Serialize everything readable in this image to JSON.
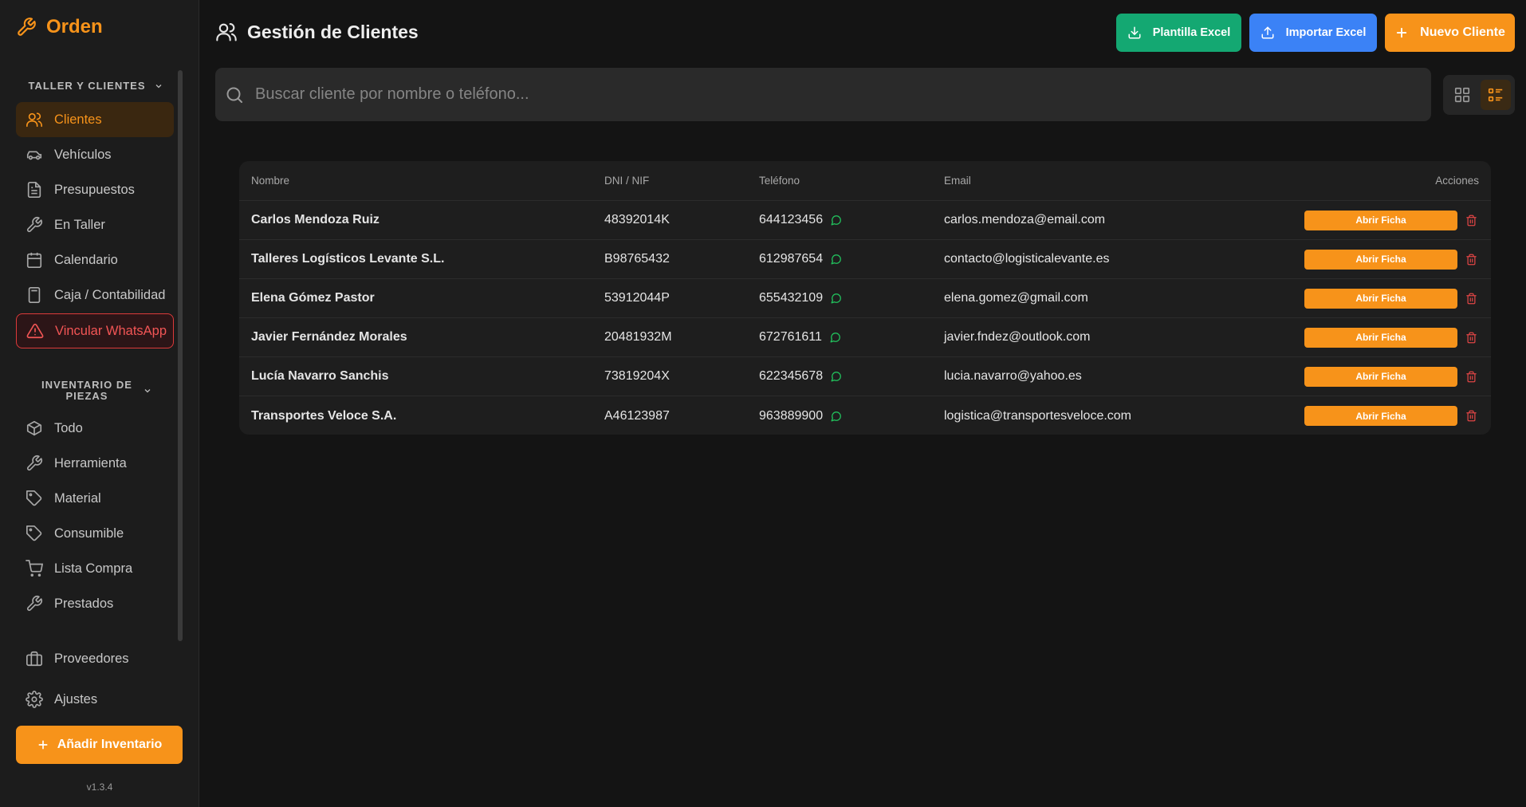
{
  "app": {
    "name": "Orden"
  },
  "sidebar": {
    "section1": "TALLER Y CLIENTES",
    "items1": [
      {
        "label": "Clientes",
        "icon": "users-icon",
        "active": true
      },
      {
        "label": "Vehículos",
        "icon": "car-icon"
      },
      {
        "label": "Presupuestos",
        "icon": "document-icon"
      },
      {
        "label": "En Taller",
        "icon": "wrench-icon"
      },
      {
        "label": "Calendario",
        "icon": "calendar-icon"
      },
      {
        "label": "Caja / Contabilidad",
        "icon": "calculator-icon"
      },
      {
        "label": "Vincular WhatsApp",
        "icon": "warning-icon",
        "alert": true
      }
    ],
    "section2": "INVENTARIO DE PIEZAS",
    "items2": [
      {
        "label": "Todo",
        "icon": "box-icon"
      },
      {
        "label": "Herramienta",
        "icon": "wrench-icon"
      },
      {
        "label": "Material",
        "icon": "tag-icon"
      },
      {
        "label": "Consumible",
        "icon": "tag-icon"
      },
      {
        "label": "Lista Compra",
        "icon": "cart-icon"
      },
      {
        "label": "Prestados",
        "icon": "wrench-icon"
      }
    ],
    "bottom": [
      {
        "label": "Proveedores",
        "icon": "briefcase-icon"
      },
      {
        "label": "Ajustes",
        "icon": "gear-icon"
      }
    ],
    "add_button": "Añadir Inventario",
    "version": "v1.3.4"
  },
  "header": {
    "title": "Gestión de Clientes",
    "btn_template": "Plantilla Excel",
    "btn_import": "Importar Excel",
    "btn_new": "Nuevo Cliente"
  },
  "search": {
    "placeholder": "Buscar cliente por nombre o teléfono..."
  },
  "table": {
    "columns": [
      "Nombre",
      "DNI / NIF",
      "Teléfono",
      "Email",
      "Acciones"
    ],
    "open_label": "Abrir Ficha",
    "rows": [
      {
        "name": "Carlos Mendoza Ruiz",
        "dni": "48392014K",
        "phone": "644123456",
        "email": "carlos.mendoza@email.com"
      },
      {
        "name": "Talleres Logísticos Levante S.L.",
        "dni": "B98765432",
        "phone": "612987654",
        "email": "contacto@logisticalevante.es"
      },
      {
        "name": "Elena Gómez Pastor",
        "dni": "53912044P",
        "phone": "655432109",
        "email": "elena.gomez@gmail.com"
      },
      {
        "name": "Javier Fernández Morales",
        "dni": "20481932M",
        "phone": "672761611",
        "email": "javier.fndez@outlook.com"
      },
      {
        "name": "Lucía Navarro Sanchis",
        "dni": "73819204X",
        "phone": "622345678",
        "email": "lucia.navarro@yahoo.es"
      },
      {
        "name": "Transportes Veloce S.A.",
        "dni": "A46123987",
        "phone": "963889900",
        "email": "logistica@transportesveloce.com"
      }
    ]
  },
  "colors": {
    "accent": "#f7931a",
    "green": "#14a872",
    "blue": "#3b82f6",
    "danger": "#e04545",
    "whatsapp": "#22c55e"
  }
}
